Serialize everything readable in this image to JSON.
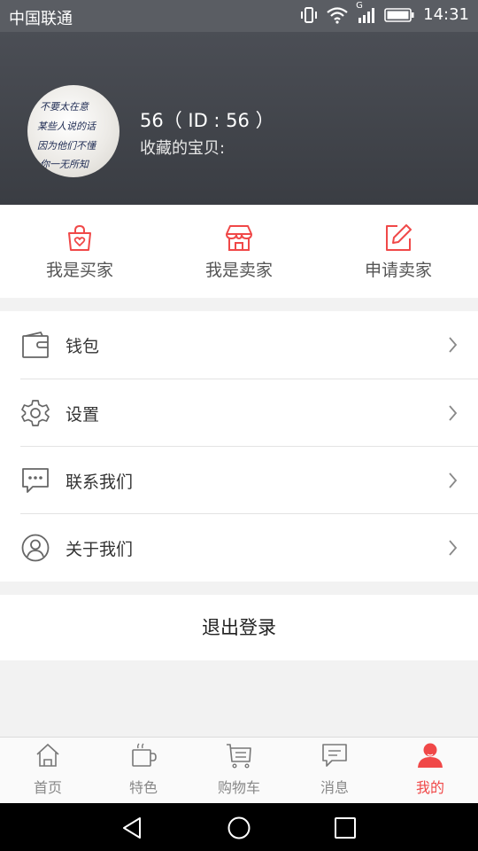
{
  "status_bar": {
    "carrier": "中国联通",
    "network": "G",
    "time": "14:31",
    "icons": [
      "vibrate-icon",
      "wifi-icon",
      "signal-icon",
      "battery-icon"
    ]
  },
  "profile": {
    "username": "56（ ID : 56 ）",
    "favorites_label": "收藏的宝贝:",
    "avatar_calligraphy": [
      "不要太在意",
      "某些人说的话",
      "因为他们不懂",
      "你一无所知"
    ]
  },
  "roles": [
    {
      "label": "我是买家",
      "icon": "shopping-bag-heart-icon"
    },
    {
      "label": "我是卖家",
      "icon": "storefront-icon"
    },
    {
      "label": "申请卖家",
      "icon": "edit-icon"
    }
  ],
  "menu": [
    {
      "label": "钱包",
      "icon": "wallet-icon"
    },
    {
      "label": "设置",
      "icon": "gear-icon"
    },
    {
      "label": "联系我们",
      "icon": "chat-icon"
    },
    {
      "label": "关于我们",
      "icon": "user-circle-icon"
    }
  ],
  "logout_label": "退出登录",
  "tabs": [
    {
      "label": "首页",
      "icon": "home-icon",
      "active": false
    },
    {
      "label": "特色",
      "icon": "cup-icon",
      "active": false
    },
    {
      "label": "购物车",
      "icon": "cart-icon",
      "active": false
    },
    {
      "label": "消息",
      "icon": "message-icon",
      "active": false
    },
    {
      "label": "我的",
      "icon": "person-icon",
      "active": true
    }
  ],
  "colors": {
    "accent": "#f04848",
    "header_bg": "#44474d",
    "status_bar_bg": "#5a5d63"
  }
}
